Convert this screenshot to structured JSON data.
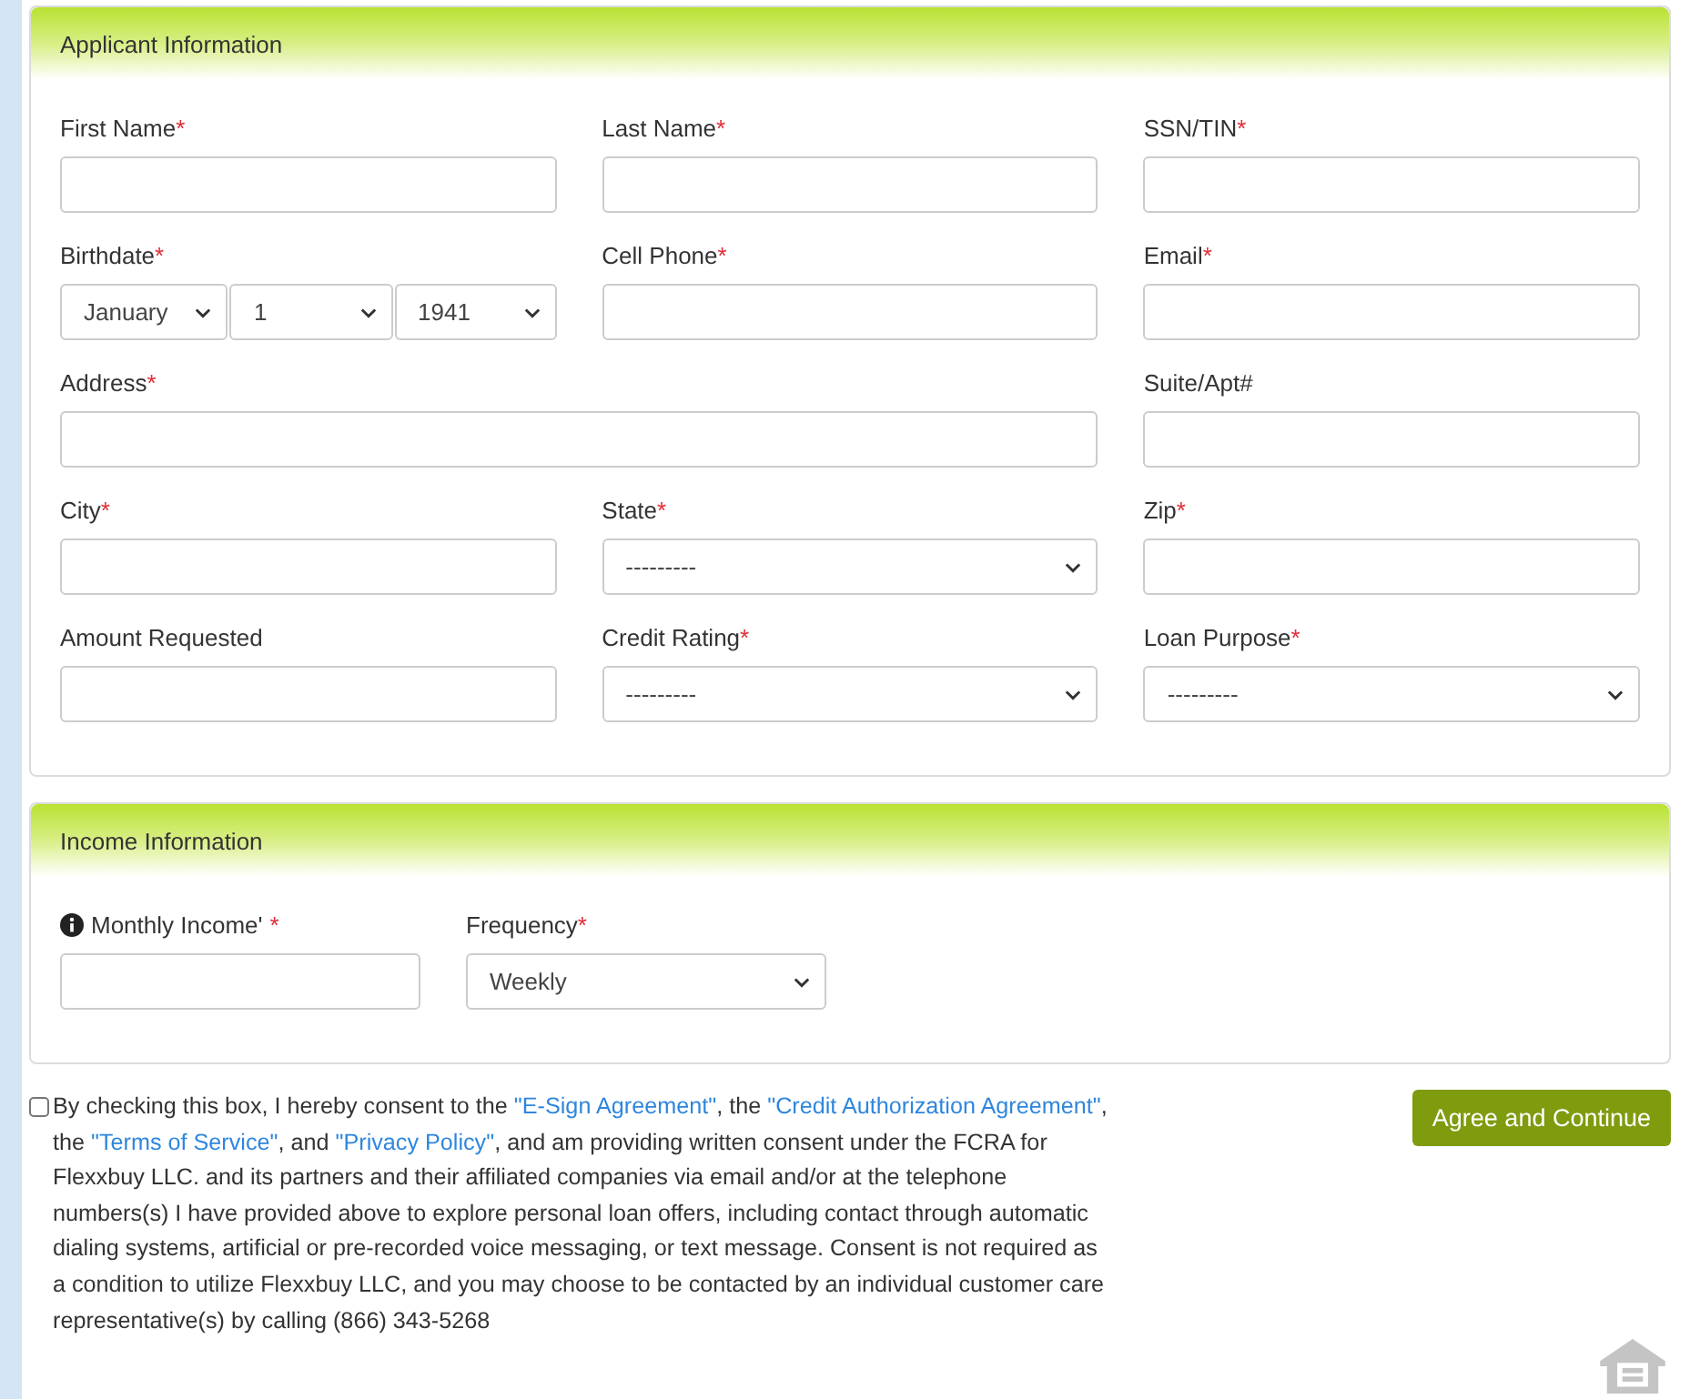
{
  "applicant": {
    "title": "Applicant Information",
    "fields": [
      {
        "label": "First Name",
        "required_mark": "*",
        "kind": "text"
      },
      {
        "label": "Last Name",
        "required_mark": "*",
        "kind": "text"
      },
      {
        "label": "SSN/TIN",
        "required_mark": "*",
        "kind": "text"
      },
      {
        "label": "Birthdate",
        "required_mark": "*",
        "kind": "date",
        "parts": [
          "January",
          "1",
          "1941"
        ]
      },
      {
        "label": "Cell Phone",
        "required_mark": "*",
        "kind": "text"
      },
      {
        "label": "Email",
        "required_mark": "*",
        "kind": "text"
      },
      {
        "label": "Address",
        "required_mark": "*",
        "kind": "wide-text"
      },
      {
        "label": "Suite/Apt#",
        "kind": "text"
      },
      {
        "label": "City",
        "required_mark": "*",
        "kind": "text"
      },
      {
        "label": "State",
        "required_mark": "*",
        "kind": "select",
        "value": "---------"
      },
      {
        "label": "Zip",
        "required_mark": "*",
        "kind": "text"
      },
      {
        "label": "Amount Requested",
        "kind": "text"
      },
      {
        "label": "Credit Rating",
        "required_mark": "*",
        "kind": "select",
        "value": "---------"
      },
      {
        "label": "Loan Purpose",
        "required_mark": "*",
        "kind": "select",
        "value": "---------"
      }
    ]
  },
  "income": {
    "title": "Income Information",
    "fields": [
      {
        "label": "Monthly Income'",
        "required_mark": "*",
        "info": true,
        "kind": "text"
      },
      {
        "label": "Frequency",
        "required_mark": "*",
        "info": false,
        "kind": "select",
        "value": "Weekly"
      }
    ]
  },
  "consent": {
    "checked": false,
    "parts": [
      {
        "kind": "text",
        "text": "By checking this box, I hereby consent to the "
      },
      {
        "kind": "link",
        "text": "\"E-Sign Agreement\""
      },
      {
        "kind": "text",
        "text": ", the "
      },
      {
        "kind": "link",
        "text": "\"Credit Authorization Agreement\""
      },
      {
        "kind": "text",
        "text": ", the "
      },
      {
        "kind": "link",
        "text": "\"Terms of Service\""
      },
      {
        "kind": "text",
        "text": ", and "
      },
      {
        "kind": "link",
        "text": "\"Privacy Policy\""
      },
      {
        "kind": "text",
        "text": ", and am providing written consent under the FCRA for Flexxbuy LLC. and its partners and their affiliated companies via email and/or at the telephone numbers(s) I have provided above to explore personal loan offers, including contact through automatic dialing systems, artificial or pre-recorded voice messaging, or text message. Consent is not required as a condition to utilize Flexxbuy LLC, and you may choose to be contacted by an individual customer care representative(s) by calling (866) 343-5268"
      }
    ]
  },
  "submit_button": "Agree and Continue"
}
